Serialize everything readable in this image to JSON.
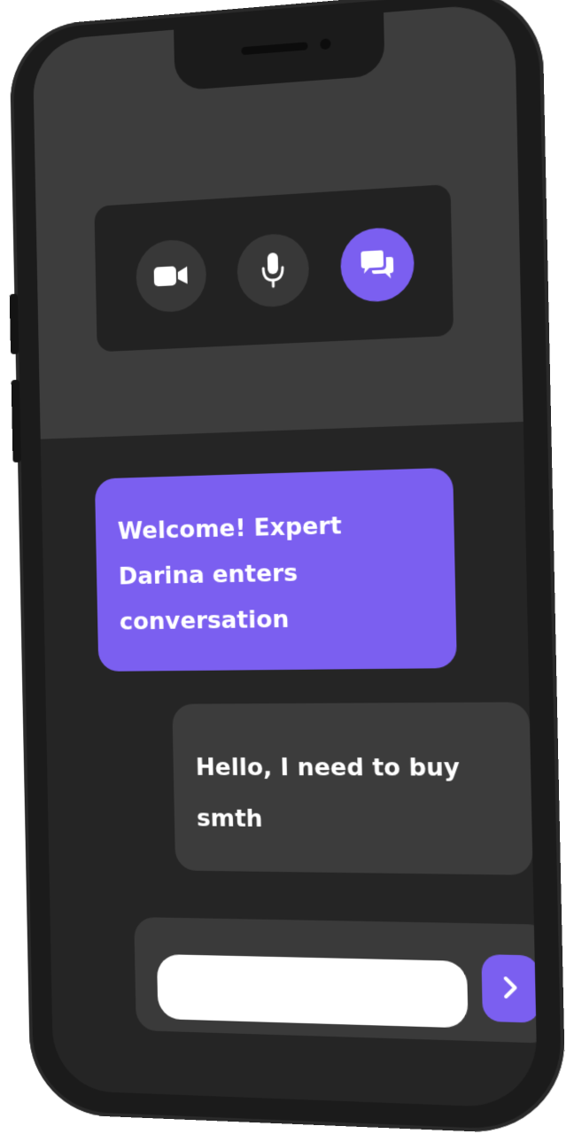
{
  "colors": {
    "accent": "#7b5ff0",
    "phone_body": "#1b1b1b",
    "screen_top": "#3d3d3d",
    "screen_bottom": "#252525",
    "call_panel": "#222222",
    "call_button": "#383838",
    "user_bubble": "#3c3c3c",
    "text": "#ffffff"
  },
  "call_controls": {
    "buttons": [
      {
        "icon": "video-camera-icon",
        "active": false
      },
      {
        "icon": "microphone-icon",
        "active": false
      },
      {
        "icon": "chat-bubbles-icon",
        "active": true
      }
    ]
  },
  "conversation": {
    "messages": [
      {
        "sender": "expert",
        "lines": [
          "Welcome! Expert",
          "Darina enters",
          "conversation"
        ]
      },
      {
        "sender": "user",
        "lines": [
          "Hello, I need to buy",
          "smth"
        ]
      }
    ]
  },
  "composer": {
    "value": "",
    "send_icon": "chevron-right-icon"
  }
}
